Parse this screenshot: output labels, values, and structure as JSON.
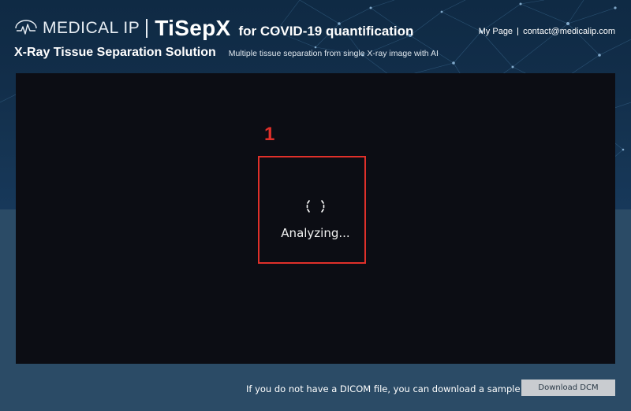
{
  "header": {
    "brand": "MEDICAL IP",
    "product": "TiSepX",
    "product_suffix": "for COVID-19 quantification",
    "subtitle": "X-Ray Tissue Separation Solution",
    "description": "Multiple tissue separation from single X-ray image with AI",
    "links": {
      "my_page": "My Page",
      "contact": "contact@medicalip.com"
    }
  },
  "viewer": {
    "status": "Analyzing...",
    "annotation_number": "1"
  },
  "footer": {
    "note": "If you do not have a DICOM file, you can download a sample file here.",
    "download_label": "Download DCM"
  },
  "colors": {
    "annotation": "#e0302a",
    "viewer_bg": "#0c0d14",
    "header_bg": "#0f2a44",
    "lower_bg": "#2b4b66",
    "button_bg": "#c9ccd0"
  },
  "icons": {
    "logo": "medical-ip-logo-icon",
    "spinner": "loading-spinner-icon"
  }
}
